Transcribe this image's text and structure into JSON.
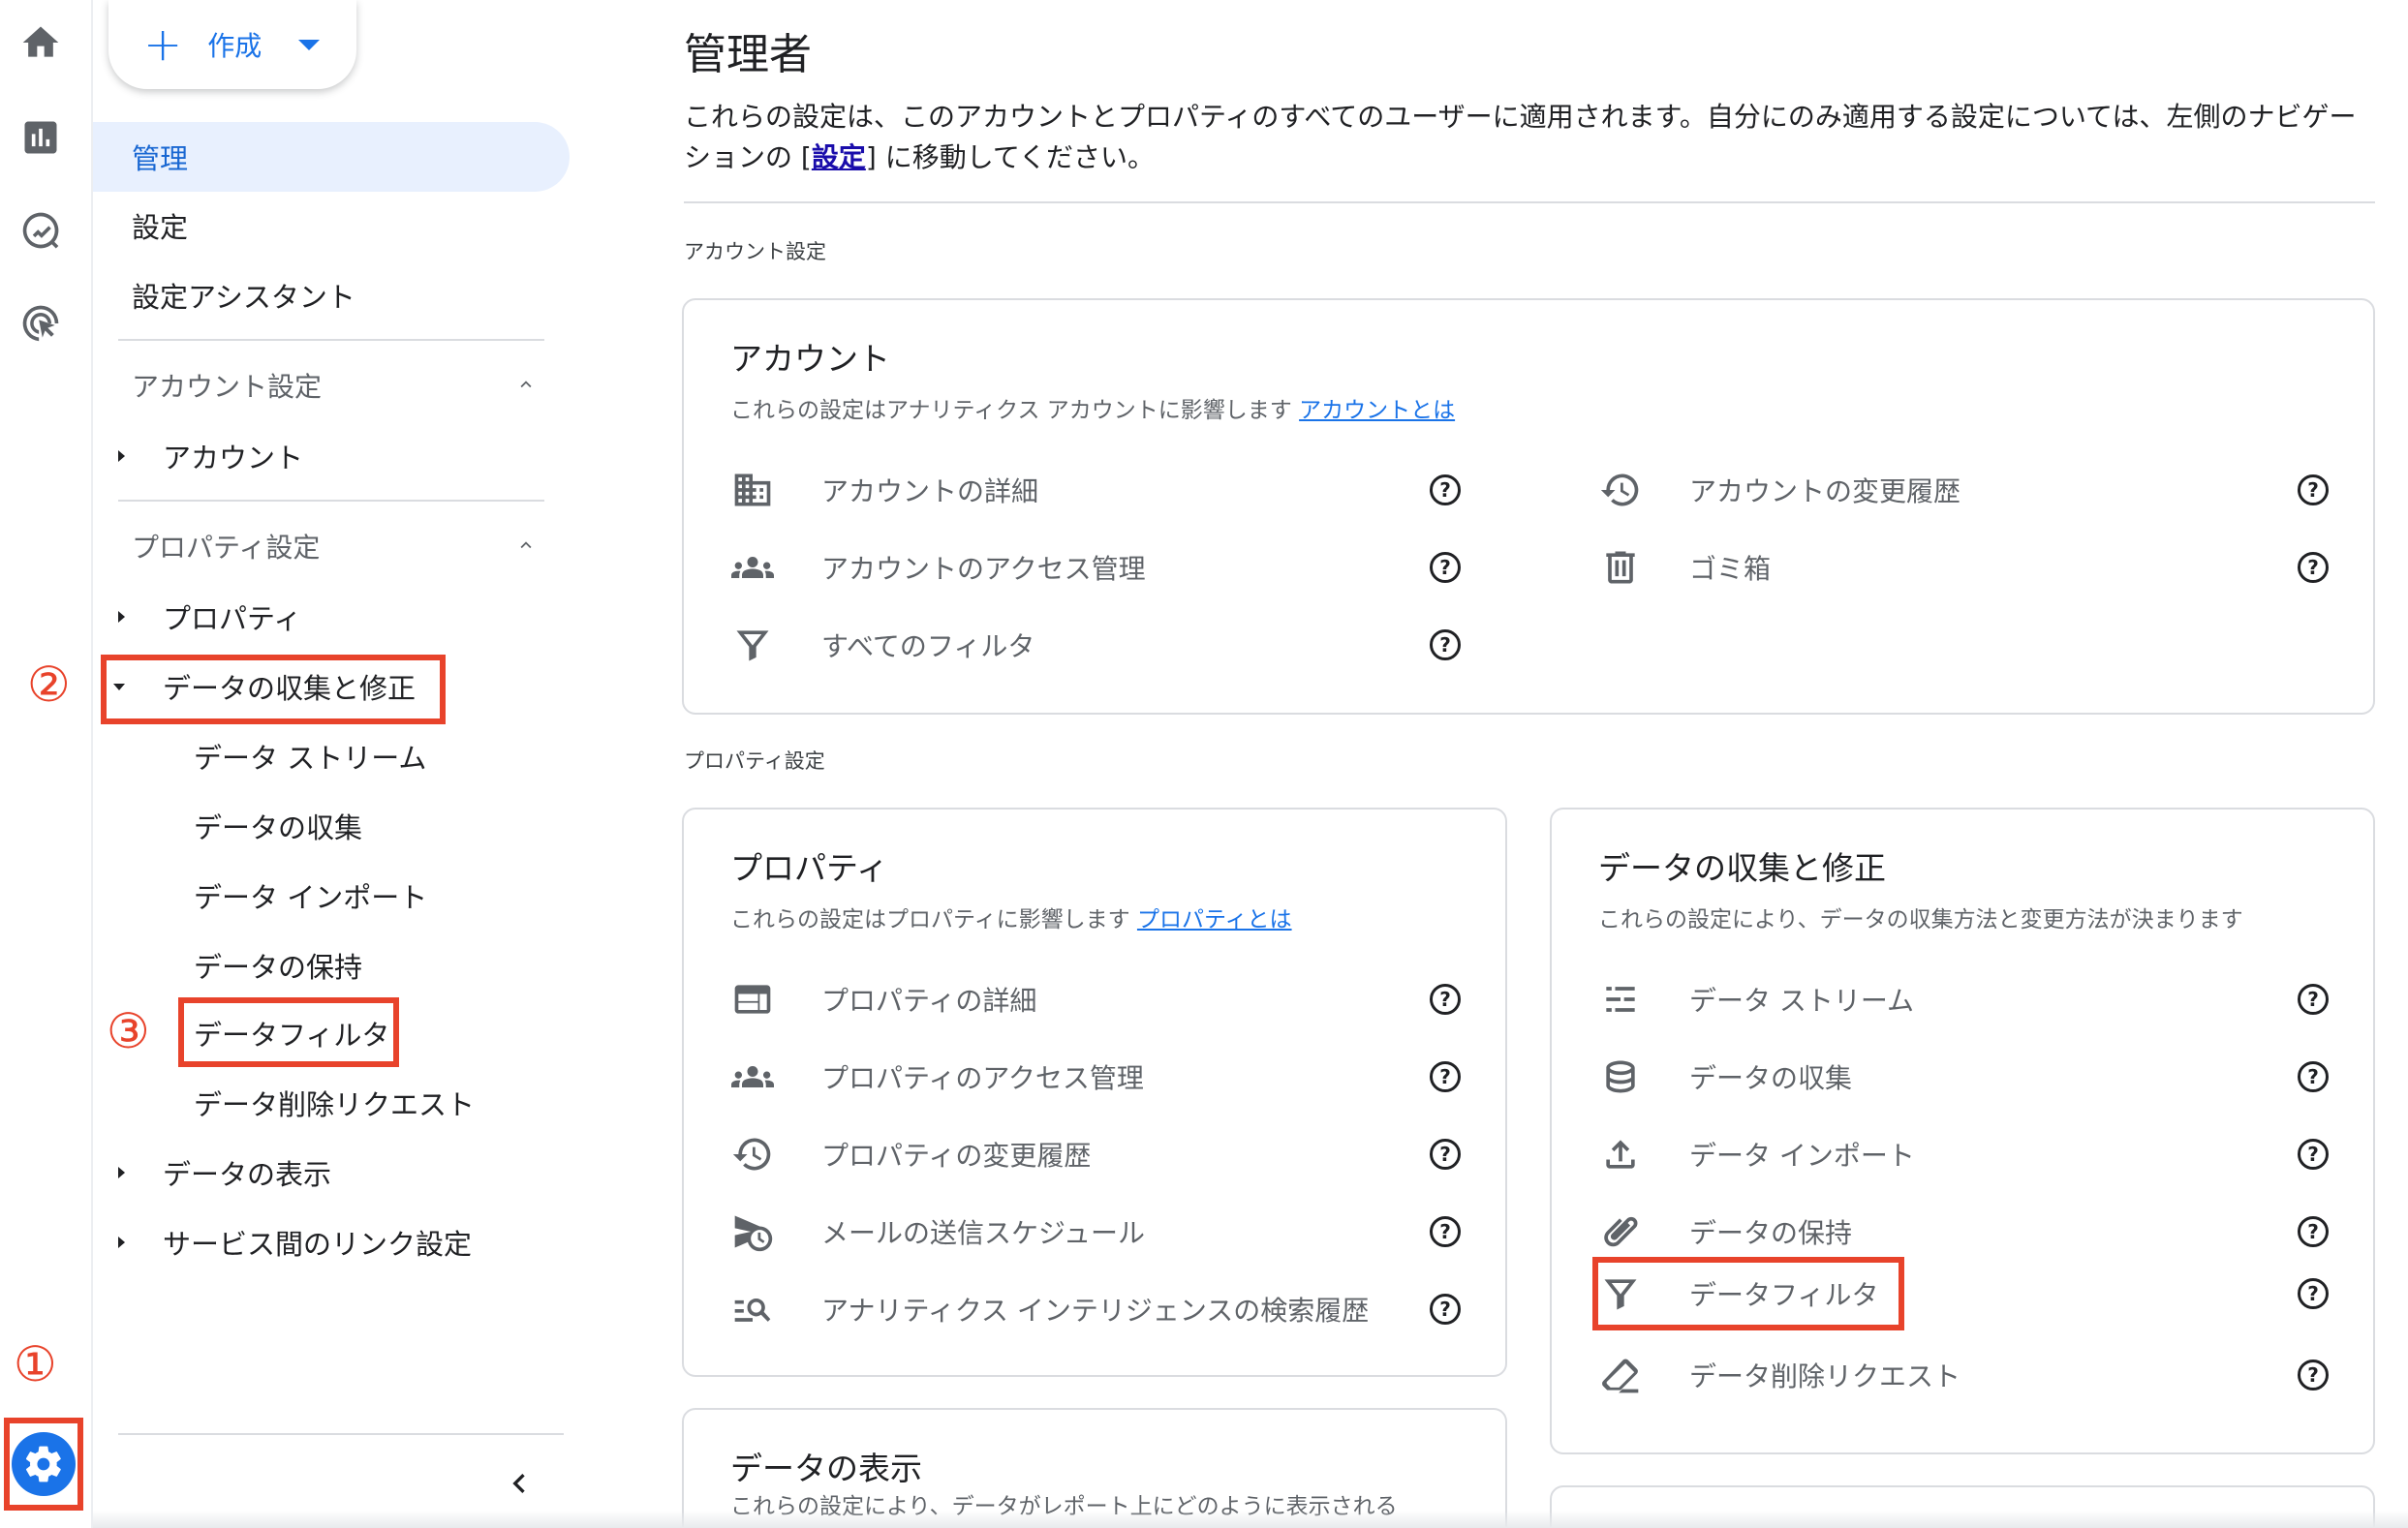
{
  "rail": {
    "items": [
      "home-icon",
      "reports-icon",
      "explore-icon",
      "advertising-icon"
    ],
    "settings": "gear-icon",
    "settings_marker": "①"
  },
  "nav": {
    "create_label": "作成",
    "admin": "管理",
    "settings": "設定",
    "setup_assistant": "設定アシスタント",
    "account_section": "アカウント設定",
    "account": "アカウント",
    "property_section": "プロパティ設定",
    "property": "プロパティ",
    "data_collection_modify": "データの収集と修正",
    "sub_items": [
      "データ ストリーム",
      "データの収集",
      "データ インポート",
      "データの保持",
      "データフィルタ",
      "データ削除リクエスト"
    ],
    "data_display": "データの表示",
    "product_links": "サービス間のリンク設定",
    "marker2": "②",
    "marker3": "③"
  },
  "main": {
    "title": "管理者",
    "desc_part1": "これらの設定は、このアカウントとプロパティのすべてのユーザーに適用されます。自分にのみ適用する設定については、左側のナビゲーションの ",
    "desc_link_bracket_open": "[",
    "desc_link": "設定",
    "desc_link_bracket_close": "]",
    "desc_part2": " に移動してください。",
    "account_label": "アカウント設定",
    "property_label": "プロパティ設定"
  },
  "account_card": {
    "title": "アカウント",
    "sub": "これらの設定はアナリティクス アカウントに影響します",
    "sub_link": "アカウントとは",
    "rows_left": [
      "アカウントの詳細",
      "アカウントのアクセス管理",
      "すべてのフィルタ"
    ],
    "rows_right": [
      "アカウントの変更履歴",
      "ゴミ箱"
    ]
  },
  "property_card": {
    "title": "プロパティ",
    "sub": "これらの設定はプロパティに影響します",
    "sub_link": "プロパティとは",
    "rows": [
      "プロパティの詳細",
      "プロパティのアクセス管理",
      "プロパティの変更履歴",
      "メールの送信スケジュール",
      "アナリティクス インテリジェンスの検索履歴"
    ]
  },
  "data_card": {
    "title": "データの収集と修正",
    "sub": "これらの設定により、データの収集方法と変更方法が決まります",
    "rows": [
      "データ ストリーム",
      "データの収集",
      "データ インポート",
      "データの保持",
      "データフィルタ",
      "データ削除リクエスト"
    ]
  },
  "display_card": {
    "title": "データの表示",
    "sub": "これらの設定により、データがレポート上にどのように表示される"
  },
  "help_glyph": "?",
  "colors": {
    "accent": "#1a73e8",
    "highlight": "#e8432b",
    "selected_bg": "#e8f0fe"
  }
}
